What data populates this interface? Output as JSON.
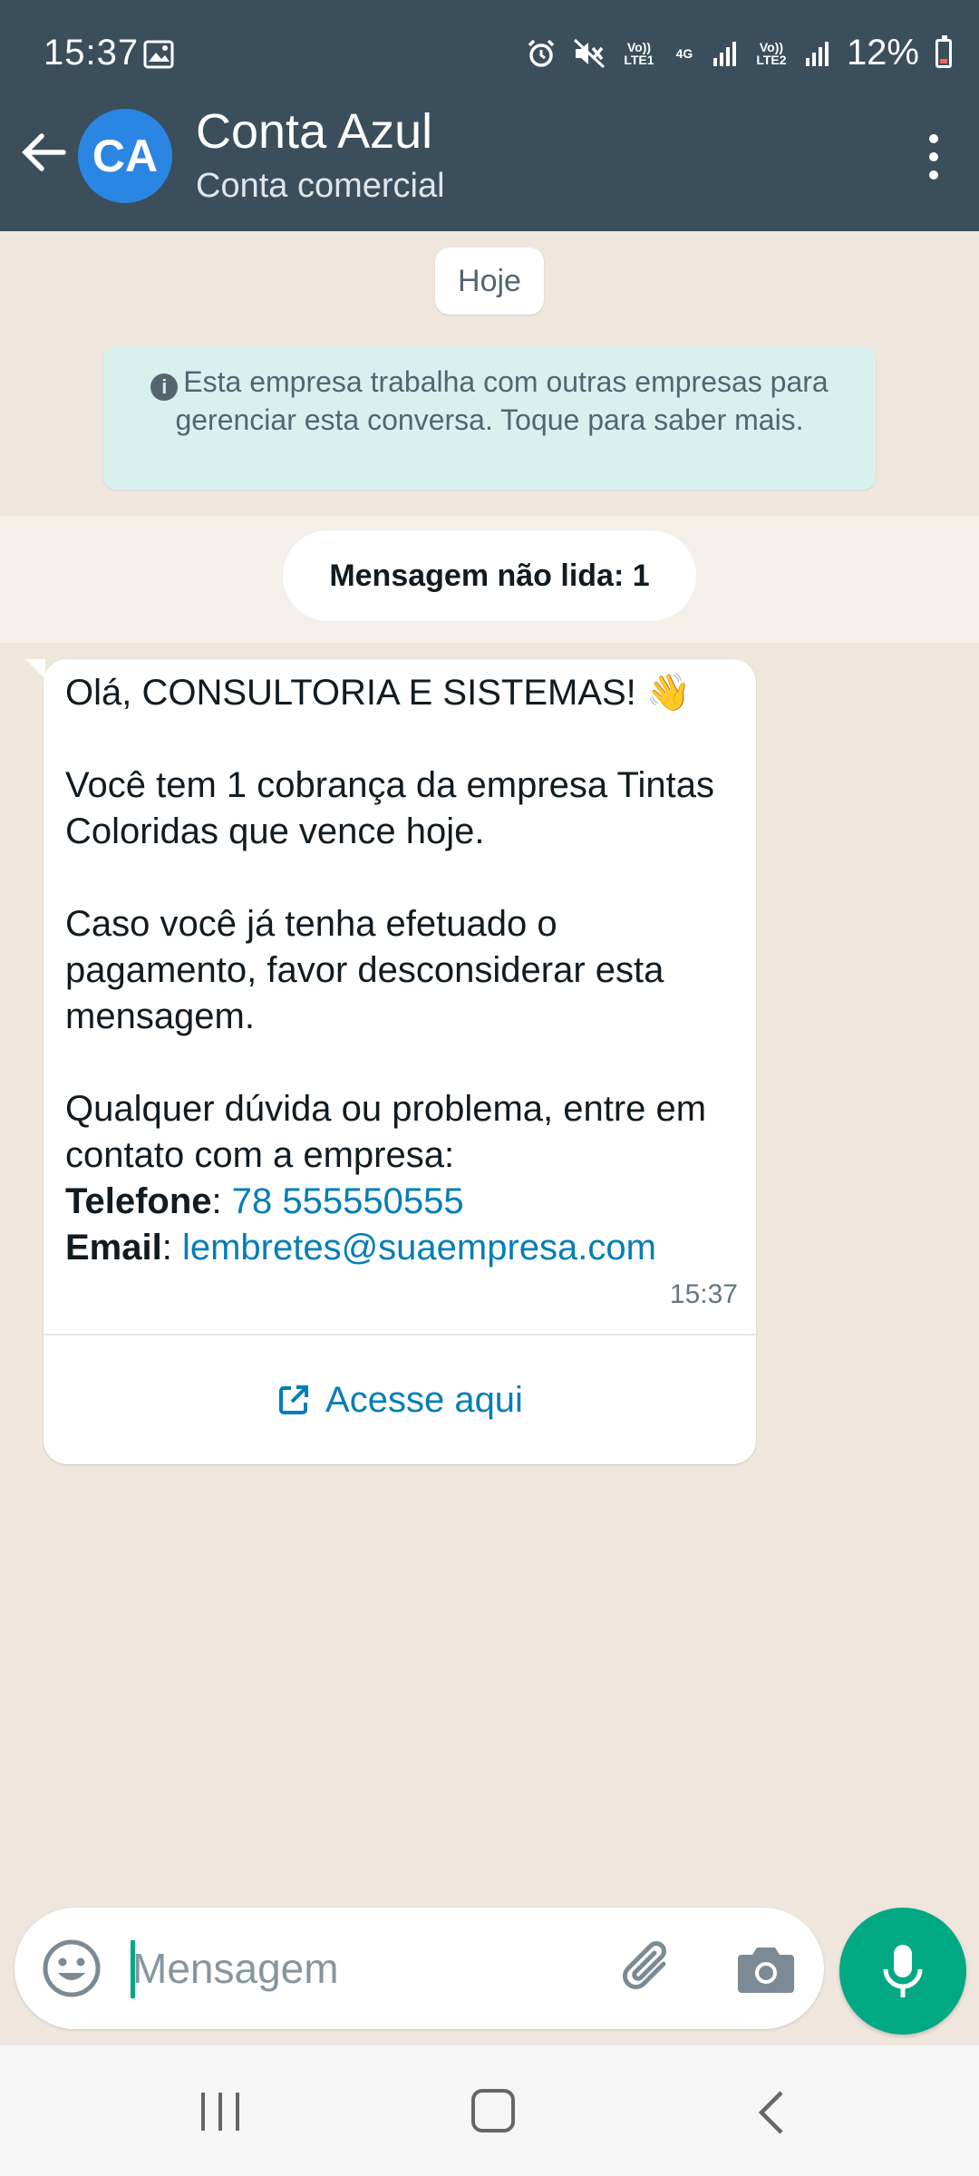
{
  "status_bar": {
    "time": "15:37",
    "battery": "12%",
    "sim1": "Vo)) LTE1",
    "sim2": "Vo)) LTE2",
    "network": "4G",
    "icons": [
      "image-icon",
      "alarm-icon",
      "mute-icon",
      "signal-icon",
      "battery-icon"
    ]
  },
  "header": {
    "avatar_initials": "CA",
    "name": "Conta Azul",
    "subtitle": "Conta comercial"
  },
  "chat": {
    "date_chip": "Hoje",
    "info_notice": "Esta empresa trabalha com outras empresas para gerenciar esta conversa. Toque para saber mais.",
    "unread_label": "Mensagem não lida: 1",
    "message": {
      "greeting": "Olá, CONSULTORIA E SISTEMAS! 👋",
      "paragraph1": "Você tem 1 cobrança da empresa Tintas Coloridas que vence hoje.",
      "paragraph2": "Caso você já tenha efetuado o pagamento, favor desconsiderar esta mensagem.",
      "paragraph3": "Qualquer dúvida ou problema, entre em contato com a empresa:",
      "phone_label": "Telefone",
      "phone_value": "78 555550555",
      "email_label": "Email",
      "email_value": "lembretes@suaempresa.com",
      "time": "15:37",
      "action_label": "Acesse aqui"
    }
  },
  "composer": {
    "placeholder": "Mensagem"
  },
  "colors": {
    "header_bg": "#3b4e5b",
    "accent_green": "#00a884",
    "link_blue": "#027eb5",
    "avatar_blue": "#2b86e3",
    "chat_bg": "#efe7dd",
    "notice_bg": "#d8f1ef"
  }
}
